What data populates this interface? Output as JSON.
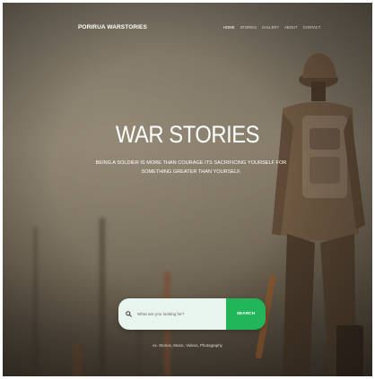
{
  "nav": {
    "brand": "PORIRUA WARSTORIES",
    "items": [
      {
        "label": "HOME",
        "active": true
      },
      {
        "label": "STORIES",
        "active": false
      },
      {
        "label": "GALLERY",
        "active": false
      },
      {
        "label": "ABOUT",
        "active": false
      },
      {
        "label": "CONTACT",
        "active": false
      }
    ]
  },
  "hero": {
    "title": "WAR STORIES",
    "subtitle": "BEING A SOLDIER IS MORE THAN COURAGE ITS SACRIFICING YOURSELF FOR SOMETHING GREATER THAN YOURSELF."
  },
  "search": {
    "placeholder": "What are you looking for?",
    "value": "",
    "button_label": "SEARCH",
    "icon": "search-icon",
    "tags_text": "ex. Stories, Music, Videos, Photography"
  },
  "colors": {
    "accent": "#21b65a",
    "search_field_bg": "#e8f5ee"
  }
}
